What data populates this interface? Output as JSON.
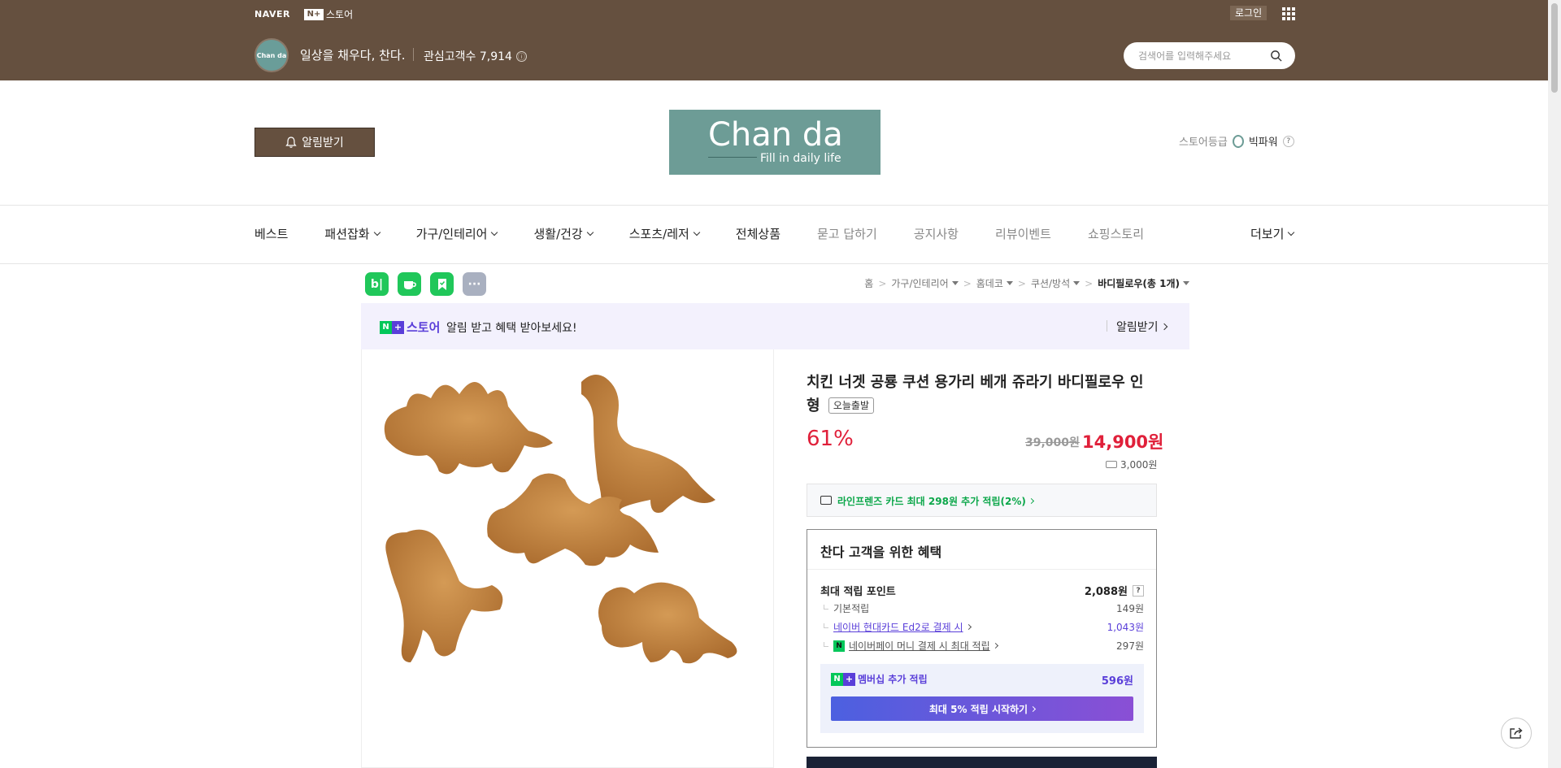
{
  "topbar": {
    "naver": "NAVER",
    "nplus_box": "N+",
    "nplus_store": "스토어",
    "login": "로그인",
    "store_avatar_text": "Chan da",
    "store_slogan": "일상을 채우다, 찬다.",
    "fans_label": "관심고객수 7,914",
    "info_icon": "ⓘ",
    "search_placeholder": "검색어를 입력해주세요"
  },
  "header": {
    "alarm_button": "알림받기",
    "logo_title": "Chan da",
    "logo_sub": "Fill in daily life",
    "grade_label": "스토어등급",
    "grade_value": "빅파워",
    "grade_help": "?"
  },
  "nav": {
    "items": [
      {
        "label": "베스트"
      },
      {
        "label": "패션잡화"
      },
      {
        "label": "가구/인테리어"
      },
      {
        "label": "생활/건강"
      },
      {
        "label": "스포츠/레저"
      },
      {
        "label": "전체상품"
      },
      {
        "label": "묻고 답하기"
      },
      {
        "label": "공지사항"
      },
      {
        "label": "리뷰이벤트"
      },
      {
        "label": "쇼핑스토리"
      }
    ],
    "more": "더보기"
  },
  "share": {
    "blog": "b|",
    "more": "···"
  },
  "breadcrumb": {
    "home": "홈",
    "c1": "가구/인테리어",
    "c2": "홈데코",
    "c3": "쿠션/방석",
    "current": "바디필로우(총 1개)"
  },
  "banner": {
    "store": "스토어",
    "message": "알림 받고 혜택 받아보세요!",
    "alarm": "알림받기"
  },
  "product": {
    "title": "치킨 너겟 공룡 쿠션 용가리 베개 쥬라기 바디필로우 인형",
    "tag": "오늘출발",
    "discount": "61%",
    "original_price": "39,000원",
    "sale_price": "14,900원",
    "shipping": "3,000원",
    "card_benefit": "라인프렌즈 카드 최대 298원 추가 적립(2%)"
  },
  "benefits": {
    "title": "찬다 고객을 위한 혜택",
    "max_point_label": "최대 적립 포인트",
    "max_point_value": "2,088원",
    "help": "?",
    "basic_label": "기본적립",
    "basic_value": "149원",
    "card_label": "네이버 현대카드 Ed2로 결제 시",
    "card_value": "1,043원",
    "npay_icon": "N",
    "npay_label": "네이버페이 머니 결제 시 최대 적립",
    "npay_value": "297원",
    "membership_label": "멤버십 추가 적립",
    "membership_value": "596원",
    "membership_button": "최대 5% 적립 시작하기"
  },
  "colors": {
    "brown": "#65503f",
    "price_red": "#e0203a",
    "naver_green": "#03c75a",
    "purple": "#5a3fd9"
  }
}
